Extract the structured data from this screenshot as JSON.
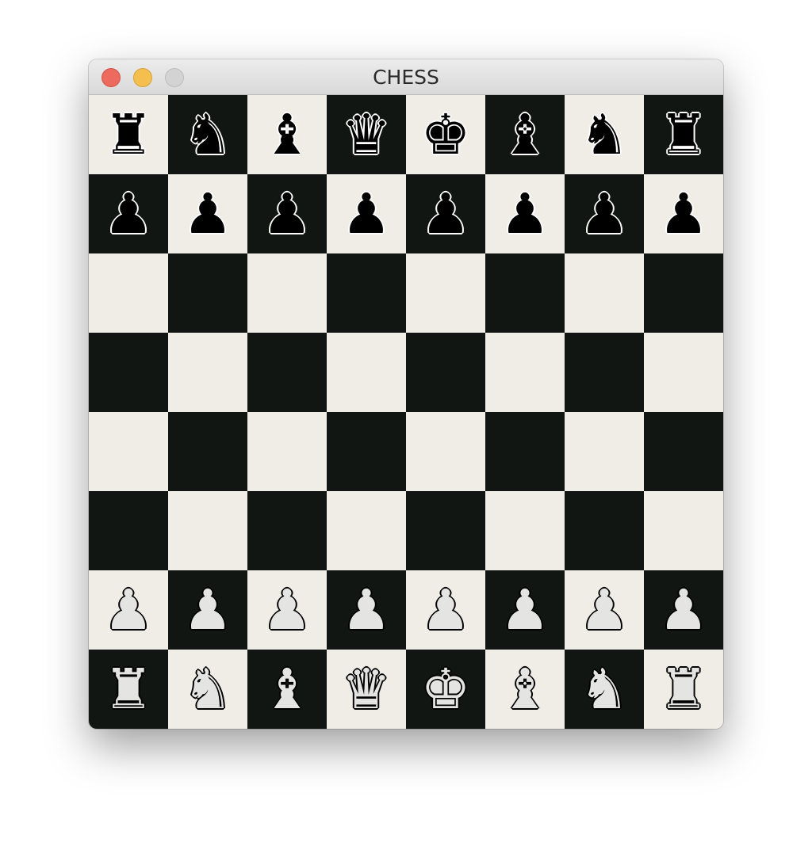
{
  "window": {
    "title": "CHESS"
  },
  "colors": {
    "light_square": "#efede6",
    "dark_square": "#111612",
    "close_button": "#ed6a5e",
    "minimize_button": "#f5bf4f",
    "zoom_button": "#d3d3d3"
  },
  "board": {
    "ranks": [
      [
        {
          "piece": "rook",
          "color": "black",
          "glyph": "♜"
        },
        {
          "piece": "knight",
          "color": "black",
          "glyph": "♞"
        },
        {
          "piece": "bishop",
          "color": "black",
          "glyph": "♝"
        },
        {
          "piece": "queen",
          "color": "black",
          "glyph": "♛"
        },
        {
          "piece": "king",
          "color": "black",
          "glyph": "♚"
        },
        {
          "piece": "bishop",
          "color": "black",
          "glyph": "♝"
        },
        {
          "piece": "knight",
          "color": "black",
          "glyph": "♞"
        },
        {
          "piece": "rook",
          "color": "black",
          "glyph": "♜"
        }
      ],
      [
        {
          "piece": "pawn",
          "color": "black",
          "glyph": "♟"
        },
        {
          "piece": "pawn",
          "color": "black",
          "glyph": "♟"
        },
        {
          "piece": "pawn",
          "color": "black",
          "glyph": "♟"
        },
        {
          "piece": "pawn",
          "color": "black",
          "glyph": "♟"
        },
        {
          "piece": "pawn",
          "color": "black",
          "glyph": "♟"
        },
        {
          "piece": "pawn",
          "color": "black",
          "glyph": "♟"
        },
        {
          "piece": "pawn",
          "color": "black",
          "glyph": "♟"
        },
        {
          "piece": "pawn",
          "color": "black",
          "glyph": "♟"
        }
      ],
      [
        null,
        null,
        null,
        null,
        null,
        null,
        null,
        null
      ],
      [
        null,
        null,
        null,
        null,
        null,
        null,
        null,
        null
      ],
      [
        null,
        null,
        null,
        null,
        null,
        null,
        null,
        null
      ],
      [
        null,
        null,
        null,
        null,
        null,
        null,
        null,
        null
      ],
      [
        {
          "piece": "pawn",
          "color": "white",
          "glyph": "♟"
        },
        {
          "piece": "pawn",
          "color": "white",
          "glyph": "♟"
        },
        {
          "piece": "pawn",
          "color": "white",
          "glyph": "♟"
        },
        {
          "piece": "pawn",
          "color": "white",
          "glyph": "♟"
        },
        {
          "piece": "pawn",
          "color": "white",
          "glyph": "♟"
        },
        {
          "piece": "pawn",
          "color": "white",
          "glyph": "♟"
        },
        {
          "piece": "pawn",
          "color": "white",
          "glyph": "♟"
        },
        {
          "piece": "pawn",
          "color": "white",
          "glyph": "♟"
        }
      ],
      [
        {
          "piece": "rook",
          "color": "white",
          "glyph": "♜"
        },
        {
          "piece": "knight",
          "color": "white",
          "glyph": "♞"
        },
        {
          "piece": "bishop",
          "color": "white",
          "glyph": "♝"
        },
        {
          "piece": "queen",
          "color": "white",
          "glyph": "♛"
        },
        {
          "piece": "king",
          "color": "white",
          "glyph": "♚"
        },
        {
          "piece": "bishop",
          "color": "white",
          "glyph": "♝"
        },
        {
          "piece": "knight",
          "color": "white",
          "glyph": "♞"
        },
        {
          "piece": "rook",
          "color": "white",
          "glyph": "♜"
        }
      ]
    ]
  }
}
